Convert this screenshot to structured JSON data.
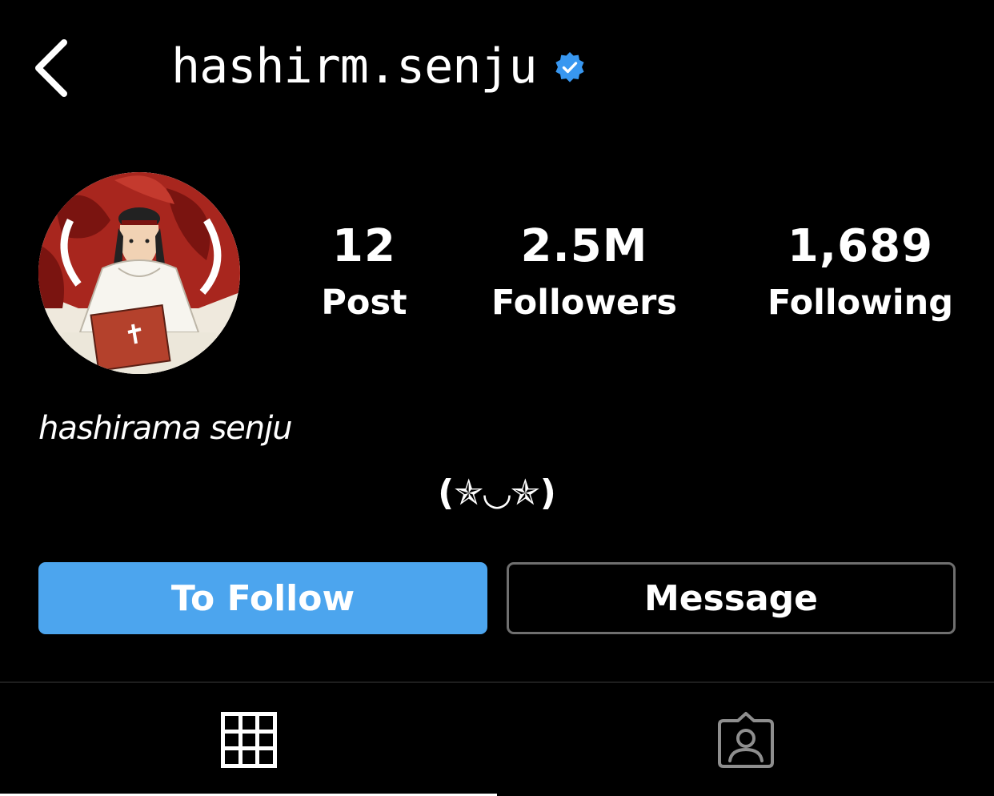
{
  "header": {
    "username": "hashirm.senju",
    "verified": true
  },
  "profile": {
    "stats": [
      {
        "value": "12",
        "label": "Post"
      },
      {
        "value": "2.5M",
        "label": "Followers"
      },
      {
        "value": "1,689",
        "label": "Following"
      }
    ],
    "display_name": "hashirama senju",
    "bio": "(✯◡✯)"
  },
  "actions": {
    "follow_label": "To Follow",
    "message_label": "Message"
  },
  "tabs": [
    {
      "icon": "grid-icon",
      "active": true
    },
    {
      "icon": "tagged-person-icon",
      "active": false
    }
  ],
  "colors": {
    "background": "#000000",
    "follow_button": "#4ca5ee",
    "verified_badge": "#3897f0",
    "message_border": "#6f6f6f"
  }
}
